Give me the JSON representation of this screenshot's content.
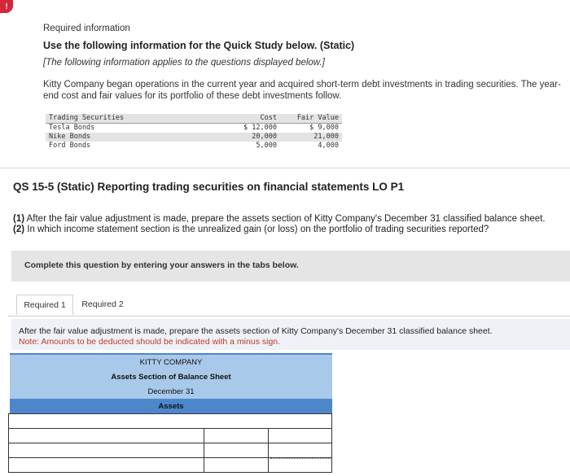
{
  "info": {
    "icon": "!",
    "required_information": "Required information",
    "use_following": "Use the following information for the Quick Study below. (Static)",
    "applies": "[The following information applies to the questions displayed below.]",
    "intro": "Kitty Company began operations in the current year and acquired short-term debt investments in trading securities. The year-end cost and fair values for its portfolio of these debt investments follow."
  },
  "securities_table": {
    "headers": [
      "Trading Securities",
      "Cost",
      "Fair Value"
    ],
    "rows": [
      [
        "Tesla Bonds",
        "$ 12,000",
        "$ 9,000"
      ],
      [
        "Nike Bonds",
        "20,000",
        "21,000"
      ],
      [
        "Ford Bonds",
        "5,000",
        "4,000"
      ]
    ]
  },
  "question": {
    "title": "QS 15-5 (Static) Reporting trading securities on financial statements LO P1",
    "part1_num": "(1)",
    "part1": " After the fair value adjustment is made, prepare the assets section of Kitty Company's December 31 classified balance sheet.",
    "part2_num": "(2)",
    "part2": " In which income statement section is the unrealized gain (or loss) on the portfolio of trading securities reported?"
  },
  "complete_banner": "Complete this question by entering your answers in the tabs below.",
  "tabs": [
    {
      "label": "Required 1",
      "active": true
    },
    {
      "label": "Required 2",
      "active": false
    }
  ],
  "instructions": {
    "line1": "After the fair value adjustment is made, prepare the assets section of Kitty Company's December 31 classified balance sheet.",
    "line2": "Note: Amounts to be deducted should be indicated with a minus sign."
  },
  "balance_sheet": {
    "company": "KITTY COMPANY",
    "title": "Assets Section of Balance Sheet",
    "date": "December 31",
    "section": "Assets",
    "rows": [
      {
        "label": "",
        "col1": "",
        "col2": ""
      },
      {
        "label": "",
        "col1": "",
        "col2": ""
      },
      {
        "label": "",
        "col1": "",
        "col2": ""
      },
      {
        "label": "",
        "col1": "",
        "col2": ""
      }
    ]
  },
  "colors": {
    "header_blue": "#4c87cc",
    "header_light_blue": "#a9c9ea",
    "note_red": "#c0392b",
    "banner_gray": "#e5e5e5",
    "alert_red": "#d9243a"
  }
}
